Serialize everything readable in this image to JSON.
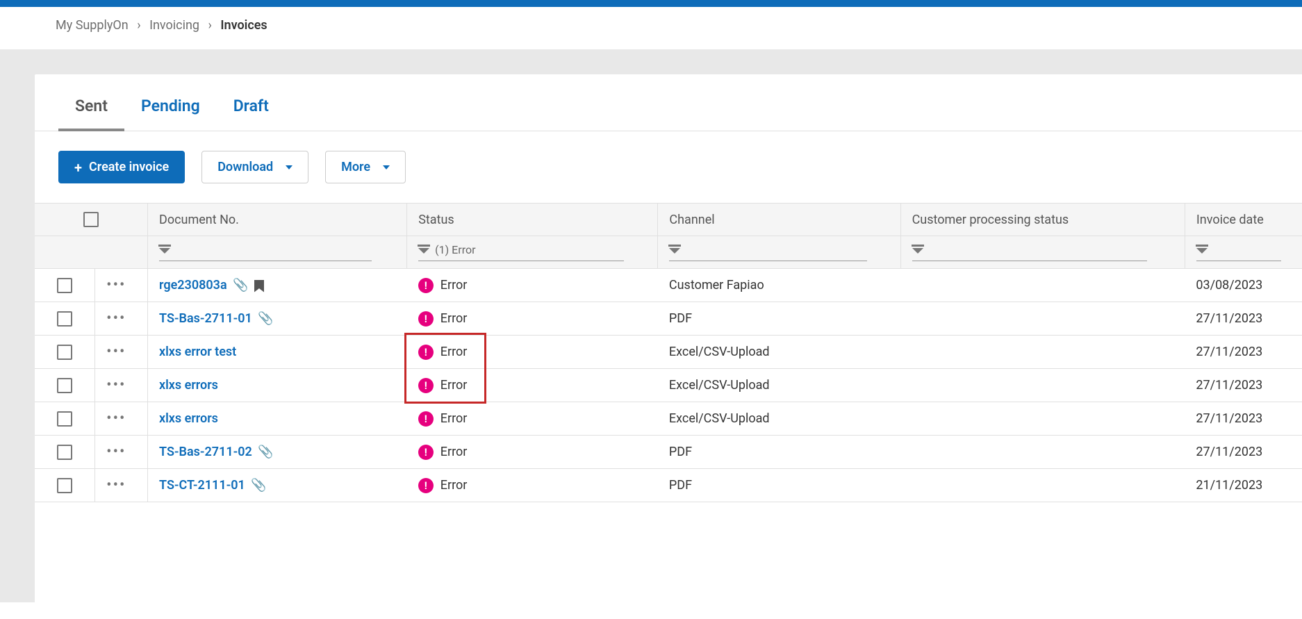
{
  "breadcrumb": {
    "root": "My SupplyOn",
    "level1": "Invoicing",
    "current": "Invoices"
  },
  "tabs": {
    "sent": "Sent",
    "pending": "Pending",
    "draft": "Draft"
  },
  "toolbar": {
    "create": "Create invoice",
    "download": "Download",
    "more": "More"
  },
  "columns": {
    "doc": "Document No.",
    "status": "Status",
    "channel": "Channel",
    "cps": "Customer processing status",
    "date": "Invoice date"
  },
  "filter": {
    "status": "(1) Error"
  },
  "status_labels": {
    "error": "Error"
  },
  "rows": [
    {
      "doc": "rge230803a",
      "attach": true,
      "bookmark": true,
      "status": "error",
      "channel": "Customer Fapiao",
      "cps": "",
      "date": "03/08/2023"
    },
    {
      "doc": "TS-Bas-2711-01",
      "attach": true,
      "bookmark": false,
      "status": "error",
      "channel": "PDF",
      "cps": "",
      "date": "27/11/2023"
    },
    {
      "doc": "xlxs error test",
      "attach": false,
      "bookmark": false,
      "status": "error",
      "channel": "Excel/CSV-Upload",
      "cps": "",
      "date": "27/11/2023",
      "highlight": true
    },
    {
      "doc": "xlxs errors",
      "attach": false,
      "bookmark": false,
      "status": "error",
      "channel": "Excel/CSV-Upload",
      "cps": "",
      "date": "27/11/2023",
      "highlight": true
    },
    {
      "doc": "xlxs errors",
      "attach": false,
      "bookmark": false,
      "status": "error",
      "channel": "Excel/CSV-Upload",
      "cps": "",
      "date": "27/11/2023"
    },
    {
      "doc": "TS-Bas-2711-02",
      "attach": true,
      "bookmark": false,
      "status": "error",
      "channel": "PDF",
      "cps": "",
      "date": "27/11/2023"
    },
    {
      "doc": "TS-CT-2111-01",
      "attach": true,
      "bookmark": false,
      "status": "error",
      "channel": "PDF",
      "cps": "",
      "date": "21/11/2023"
    }
  ]
}
